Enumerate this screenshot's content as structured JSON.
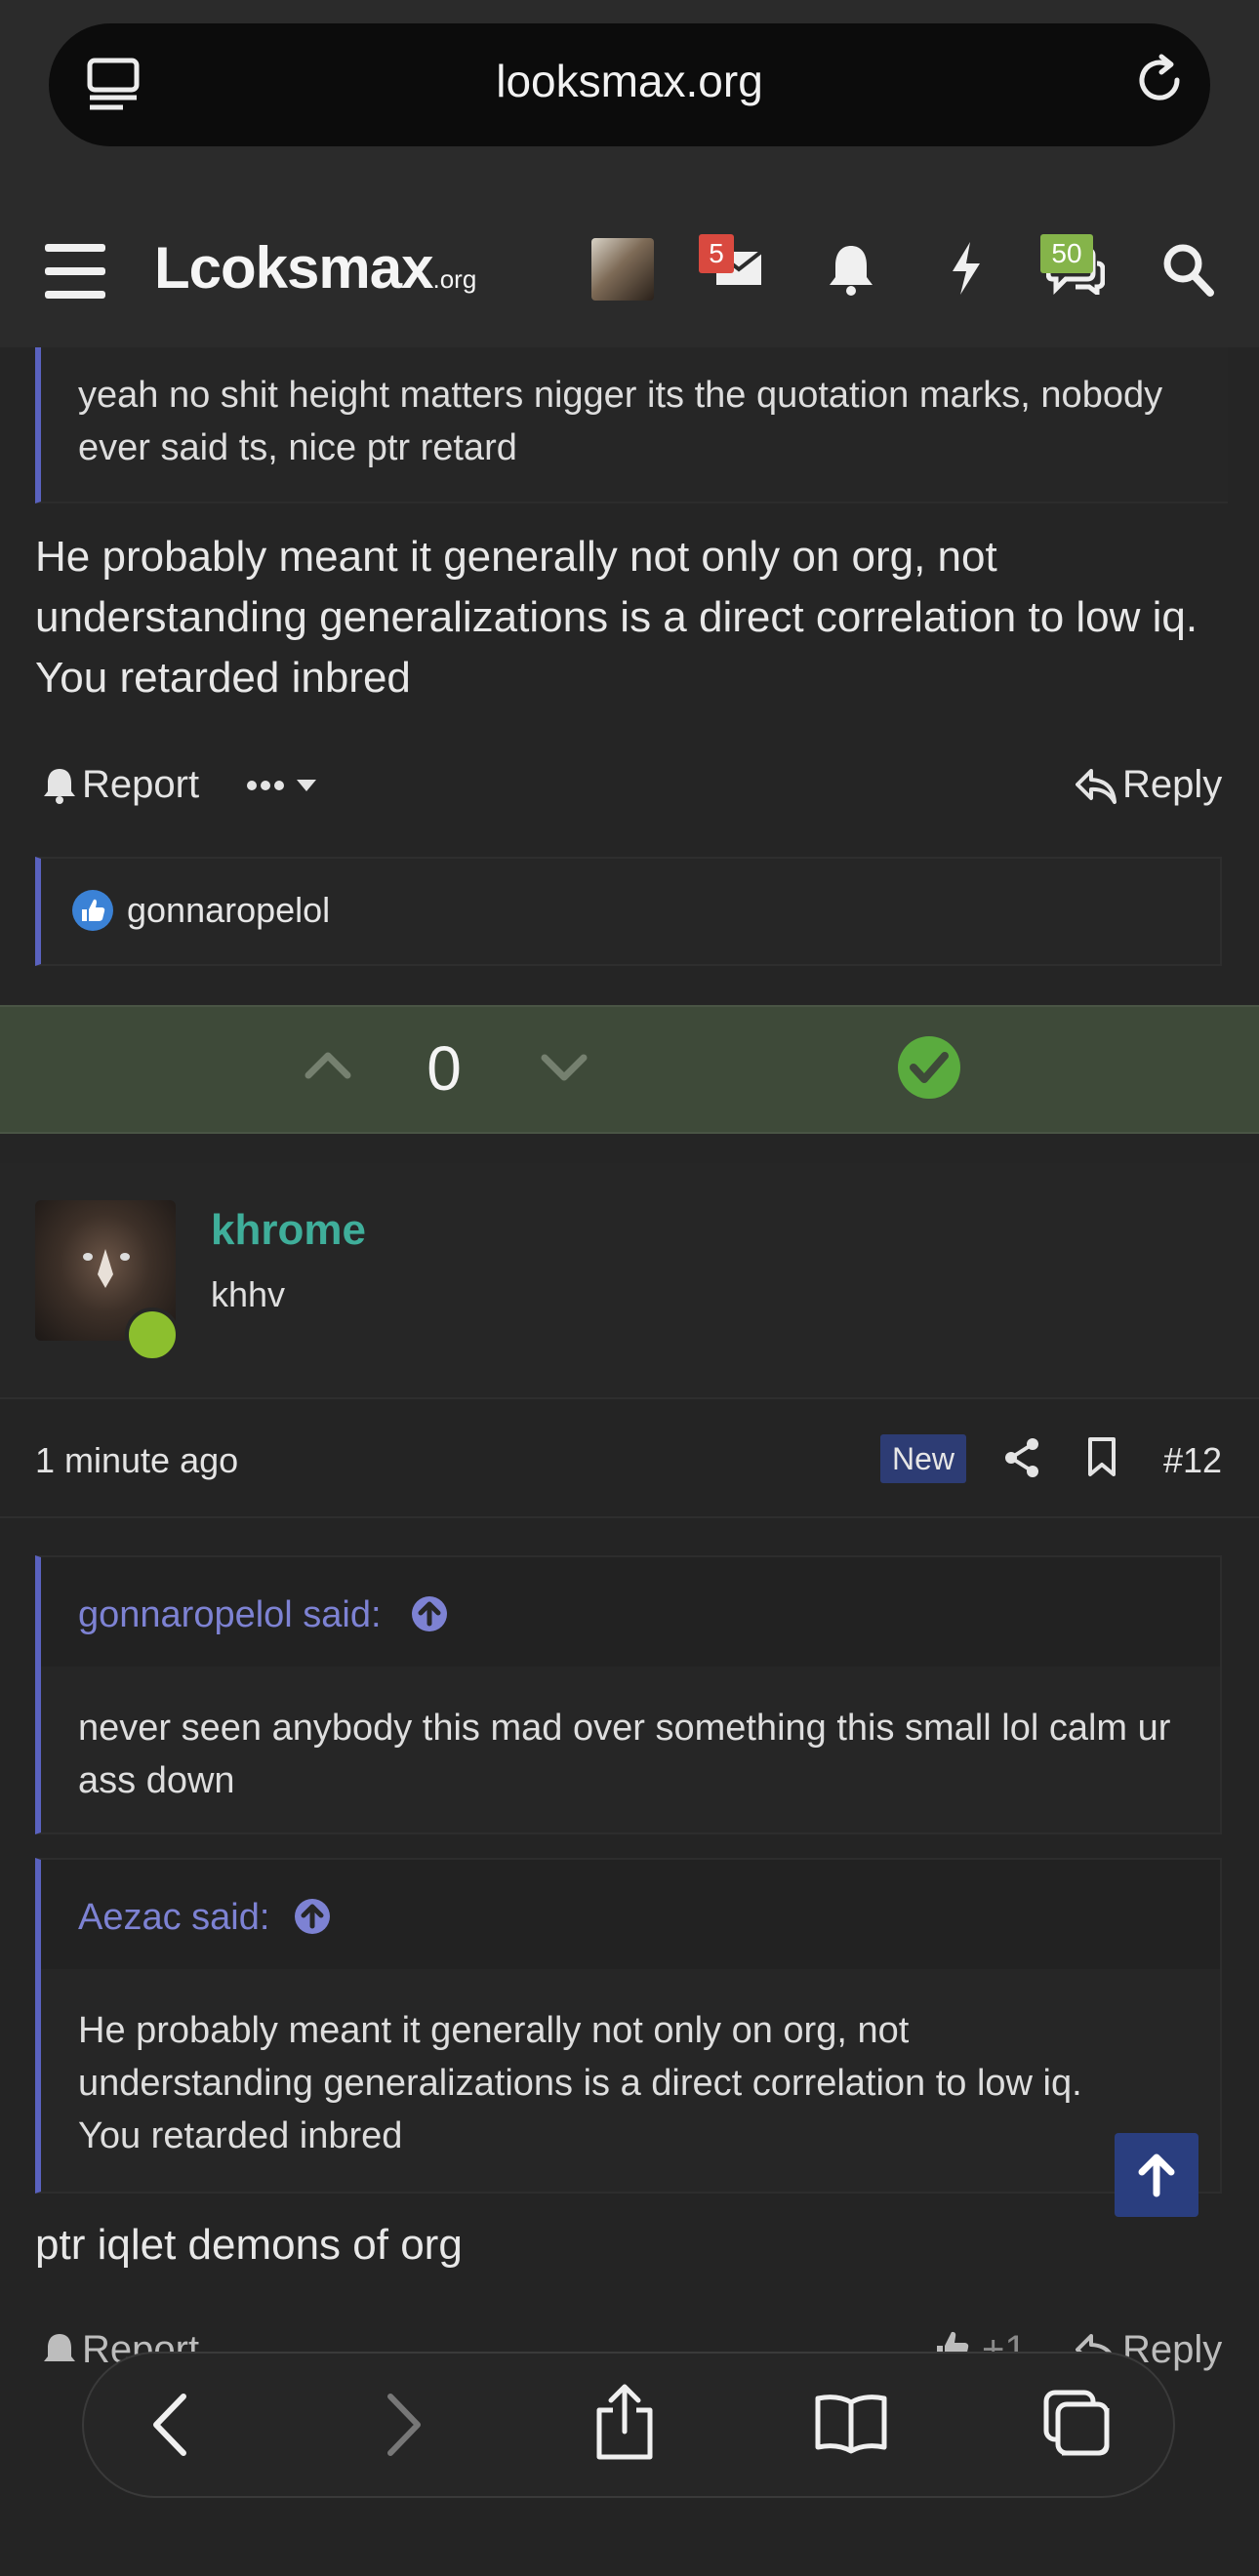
{
  "browser": {
    "url": "looksmax.org"
  },
  "header": {
    "logo_main": "Lcoksmax",
    "logo_suffix": ".org",
    "inbox_badge": "5",
    "alerts_badge": "50"
  },
  "post1": {
    "quote_text": "yeah no shit height matters nigger its the quotation marks, nobody ever said ts, nice ptr retard",
    "body": "He probably meant it generally not only on org, not understanding generalizations is a direct correlation to low iq. You retarded inbred",
    "report_label": "Report",
    "reply_label": "Reply",
    "reaction_user": "gonnaropelol",
    "vote_count": "0"
  },
  "post2": {
    "username": "khrome",
    "user_title": "khhv",
    "time": "1 minute ago",
    "new_label": "New",
    "post_number": "#12",
    "quote1": {
      "author": "gonnaropelol said:",
      "text": "never seen anybody this mad over something this small lol calm ur ass down"
    },
    "quote2": {
      "author": "Aezac said:",
      "text": "He probably meant it generally not only on org, not understanding generalizations is a direct correlation to low iq. You retarded inbred"
    },
    "body": "ptr iqlet demons of org",
    "report_label": "Report",
    "like_count": "+1",
    "reply_label": "Reply"
  },
  "colors": {
    "accent_quote": "#5a62bf",
    "username": "#3fae9a",
    "online": "#8cbf2e",
    "vote_bar": "#3e4a39",
    "check": "#5aab3e"
  }
}
